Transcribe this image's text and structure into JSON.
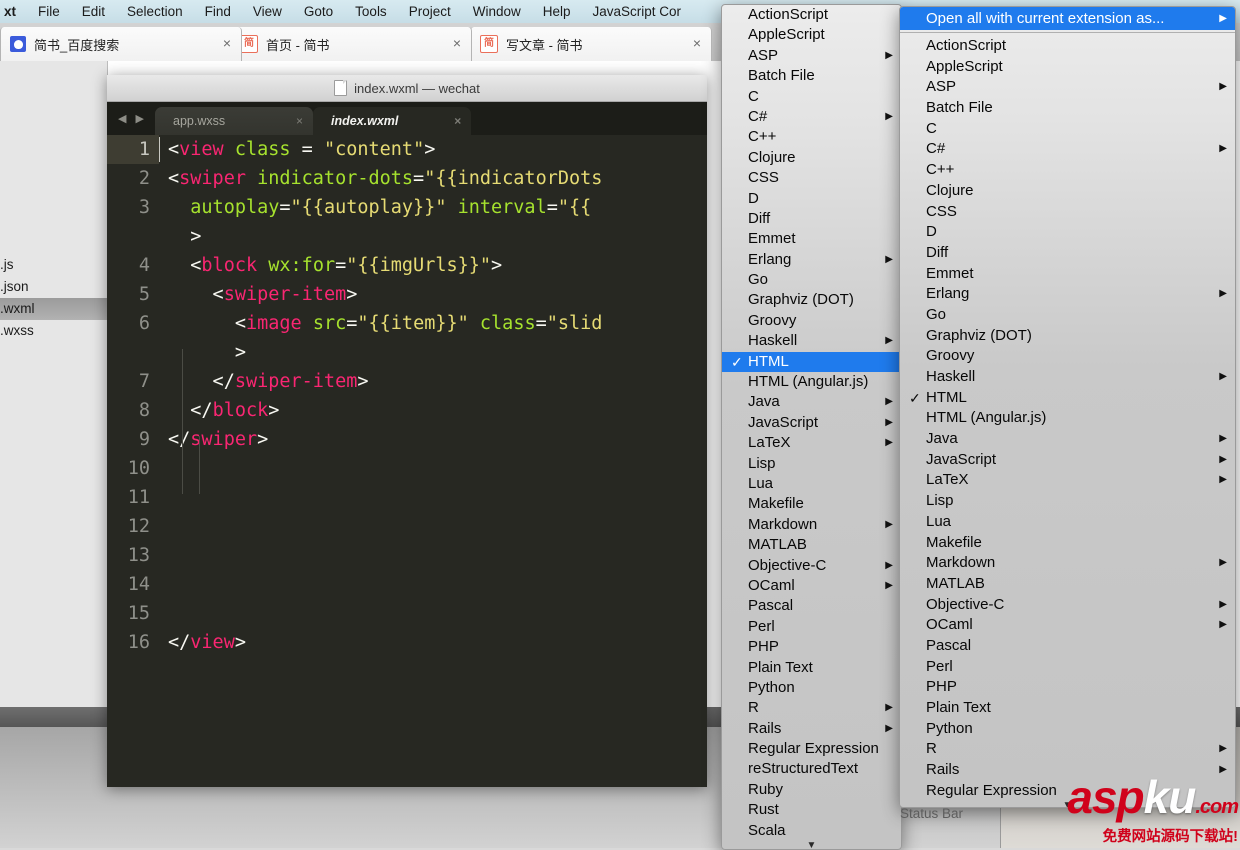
{
  "mac_menubar": {
    "items": [
      {
        "label": "xt",
        "name": "app-name"
      },
      {
        "label": "File"
      },
      {
        "label": "Edit"
      },
      {
        "label": "Selection"
      },
      {
        "label": "Find"
      },
      {
        "label": "View"
      },
      {
        "label": "Goto"
      },
      {
        "label": "Tools"
      },
      {
        "label": "Project"
      },
      {
        "label": "Window"
      },
      {
        "label": "Help"
      },
      {
        "label": "JavaScript Cor"
      }
    ]
  },
  "browser": {
    "tabs": [
      {
        "title": "简书_百度搜索",
        "favicon": "baidu-paw-icon",
        "favicon_char": "",
        "close": "×"
      },
      {
        "title": "首页 - 简书",
        "favicon": "jianshu-icon",
        "favicon_char": "简",
        "close": "×"
      },
      {
        "title": "写文章 - 简书",
        "favicon": "jianshu-icon",
        "favicon_char": "简",
        "close": "×"
      }
    ],
    "sidebar_files": [
      ".js",
      ".json",
      ".wxml",
      ".wxss"
    ],
    "sidebar_selected_index": 2
  },
  "sublime": {
    "window_title": "index.wxml — wechat",
    "title_icon": "document-icon",
    "nav_prev_icon": "◀",
    "nav_next_icon": "▶",
    "tabs": [
      {
        "name": "app.wxss",
        "active": false,
        "close": "×"
      },
      {
        "name": "index.wxml",
        "active": true,
        "close": "×"
      }
    ],
    "status_bar_label": "Status Bar",
    "code_lines": [
      {
        "num": "1",
        "current": true,
        "tokens": [
          {
            "t": "<",
            "c": "wht"
          },
          {
            "t": "view",
            "c": "pnk"
          },
          {
            "t": " ",
            "c": "wht"
          },
          {
            "t": "class",
            "c": "grn"
          },
          {
            "t": " = ",
            "c": "wht"
          },
          {
            "t": "\"content\"",
            "c": "yel"
          },
          {
            "t": ">",
            "c": "wht"
          }
        ]
      },
      {
        "num": "2",
        "current": false,
        "tokens": [
          {
            "t": "<",
            "c": "wht"
          },
          {
            "t": "swiper",
            "c": "pnk"
          },
          {
            "t": " ",
            "c": "wht"
          },
          {
            "t": "indicator-dots",
            "c": "grn"
          },
          {
            "t": "=",
            "c": "wht"
          },
          {
            "t": "\"{{indicatorDots",
            "c": "yel"
          }
        ]
      },
      {
        "num": "3",
        "current": false,
        "tokens": [
          {
            "t": "  ",
            "c": "wht"
          },
          {
            "t": "autoplay",
            "c": "grn"
          },
          {
            "t": "=",
            "c": "wht"
          },
          {
            "t": "\"{{autoplay}}\"",
            "c": "yel"
          },
          {
            "t": " ",
            "c": "wht"
          },
          {
            "t": "interval",
            "c": "grn"
          },
          {
            "t": "=",
            "c": "wht"
          },
          {
            "t": "\"{{",
            "c": "yel"
          }
        ]
      },
      {
        "num": "",
        "current": false,
        "tokens": [
          {
            "t": "  >",
            "c": "wht"
          }
        ]
      },
      {
        "num": "4",
        "current": false,
        "tokens": [
          {
            "t": "  <",
            "c": "wht"
          },
          {
            "t": "block",
            "c": "pnk"
          },
          {
            "t": " ",
            "c": "wht"
          },
          {
            "t": "wx:for",
            "c": "grn"
          },
          {
            "t": "=",
            "c": "wht"
          },
          {
            "t": "\"{{imgUrls}}\"",
            "c": "yel"
          },
          {
            "t": ">",
            "c": "wht"
          }
        ]
      },
      {
        "num": "5",
        "current": false,
        "tokens": [
          {
            "t": "    <",
            "c": "wht"
          },
          {
            "t": "swiper-item",
            "c": "pnk"
          },
          {
            "t": ">",
            "c": "wht"
          }
        ]
      },
      {
        "num": "6",
        "current": false,
        "tokens": [
          {
            "t": "      <",
            "c": "wht"
          },
          {
            "t": "image",
            "c": "pnk"
          },
          {
            "t": " ",
            "c": "wht"
          },
          {
            "t": "src",
            "c": "grn"
          },
          {
            "t": "=",
            "c": "wht"
          },
          {
            "t": "\"{{item}}\"",
            "c": "yel"
          },
          {
            "t": " ",
            "c": "wht"
          },
          {
            "t": "class",
            "c": "grn"
          },
          {
            "t": "=",
            "c": "wht"
          },
          {
            "t": "\"slid",
            "c": "yel"
          }
        ]
      },
      {
        "num": "",
        "current": false,
        "tokens": [
          {
            "t": "      >",
            "c": "wht"
          }
        ]
      },
      {
        "num": "7",
        "current": false,
        "tokens": [
          {
            "t": "    </",
            "c": "wht"
          },
          {
            "t": "swiper-item",
            "c": "pnk"
          },
          {
            "t": ">",
            "c": "wht"
          }
        ]
      },
      {
        "num": "8",
        "current": false,
        "tokens": [
          {
            "t": "  </",
            "c": "wht"
          },
          {
            "t": "block",
            "c": "pnk"
          },
          {
            "t": ">",
            "c": "wht"
          }
        ]
      },
      {
        "num": "9",
        "current": false,
        "tokens": [
          {
            "t": "</",
            "c": "wht"
          },
          {
            "t": "swiper",
            "c": "pnk"
          },
          {
            "t": ">",
            "c": "wht"
          }
        ]
      },
      {
        "num": "10",
        "current": false,
        "tokens": []
      },
      {
        "num": "11",
        "current": false,
        "tokens": []
      },
      {
        "num": "12",
        "current": false,
        "tokens": []
      },
      {
        "num": "13",
        "current": false,
        "tokens": []
      },
      {
        "num": "14",
        "current": false,
        "tokens": []
      },
      {
        "num": "15",
        "current": false,
        "tokens": []
      },
      {
        "num": "16",
        "current": false,
        "tokens": [
          {
            "t": "</",
            "c": "wht"
          },
          {
            "t": "view",
            "c": "pnk"
          },
          {
            "t": ">",
            "c": "wht"
          }
        ]
      }
    ]
  },
  "menu_syntax": {
    "name": "syntax-menu",
    "scroll_down_icon": "▼",
    "checked_item": "HTML",
    "items": [
      {
        "label": "ActionScript",
        "submenu": false,
        "checked": false
      },
      {
        "label": "AppleScript",
        "submenu": false,
        "checked": false
      },
      {
        "label": "ASP",
        "submenu": true,
        "checked": false
      },
      {
        "label": "Batch File",
        "submenu": false,
        "checked": false
      },
      {
        "label": "C",
        "submenu": false,
        "checked": false
      },
      {
        "label": "C#",
        "submenu": true,
        "checked": false
      },
      {
        "label": "C++",
        "submenu": false,
        "checked": false
      },
      {
        "label": "Clojure",
        "submenu": false,
        "checked": false
      },
      {
        "label": "CSS",
        "submenu": false,
        "checked": false
      },
      {
        "label": "D",
        "submenu": false,
        "checked": false
      },
      {
        "label": "Diff",
        "submenu": false,
        "checked": false
      },
      {
        "label": "Emmet",
        "submenu": false,
        "checked": false
      },
      {
        "label": "Erlang",
        "submenu": true,
        "checked": false
      },
      {
        "label": "Go",
        "submenu": false,
        "checked": false
      },
      {
        "label": "Graphviz (DOT)",
        "submenu": false,
        "checked": false
      },
      {
        "label": "Groovy",
        "submenu": false,
        "checked": false
      },
      {
        "label": "Haskell",
        "submenu": true,
        "checked": false
      },
      {
        "label": "HTML",
        "submenu": false,
        "checked": true,
        "selected": true
      },
      {
        "label": "HTML (Angular.js)",
        "submenu": false,
        "checked": false
      },
      {
        "label": "Java",
        "submenu": true,
        "checked": false
      },
      {
        "label": "JavaScript",
        "submenu": true,
        "checked": false
      },
      {
        "label": "LaTeX",
        "submenu": true,
        "checked": false
      },
      {
        "label": "Lisp",
        "submenu": false,
        "checked": false
      },
      {
        "label": "Lua",
        "submenu": false,
        "checked": false
      },
      {
        "label": "Makefile",
        "submenu": false,
        "checked": false
      },
      {
        "label": "Markdown",
        "submenu": true,
        "checked": false
      },
      {
        "label": "MATLAB",
        "submenu": false,
        "checked": false
      },
      {
        "label": "Objective-C",
        "submenu": true,
        "checked": false
      },
      {
        "label": "OCaml",
        "submenu": true,
        "checked": false
      },
      {
        "label": "Pascal",
        "submenu": false,
        "checked": false
      },
      {
        "label": "Perl",
        "submenu": false,
        "checked": false
      },
      {
        "label": "PHP",
        "submenu": false,
        "checked": false
      },
      {
        "label": "Plain Text",
        "submenu": false,
        "checked": false
      },
      {
        "label": "Python",
        "submenu": false,
        "checked": false
      },
      {
        "label": "R",
        "submenu": true,
        "checked": false
      },
      {
        "label": "Rails",
        "submenu": true,
        "checked": false
      },
      {
        "label": "Regular Expression",
        "submenu": false,
        "checked": false
      },
      {
        "label": "reStructuredText",
        "submenu": false,
        "checked": false
      },
      {
        "label": "Ruby",
        "submenu": false,
        "checked": false
      },
      {
        "label": "Rust",
        "submenu": false,
        "checked": false
      },
      {
        "label": "Scala",
        "submenu": false,
        "checked": false
      }
    ]
  },
  "menu_submenu": {
    "name": "open-all-with-extension-submenu",
    "header": {
      "label": "Open all with current extension as...",
      "submenu": true,
      "selected": true
    },
    "scroll_down_icon": "▼",
    "items": [
      {
        "label": "ActionScript",
        "submenu": false,
        "checked": false
      },
      {
        "label": "AppleScript",
        "submenu": false,
        "checked": false
      },
      {
        "label": "ASP",
        "submenu": true,
        "checked": false
      },
      {
        "label": "Batch File",
        "submenu": false,
        "checked": false
      },
      {
        "label": "C",
        "submenu": false,
        "checked": false
      },
      {
        "label": "C#",
        "submenu": true,
        "checked": false
      },
      {
        "label": "C++",
        "submenu": false,
        "checked": false
      },
      {
        "label": "Clojure",
        "submenu": false,
        "checked": false
      },
      {
        "label": "CSS",
        "submenu": false,
        "checked": false
      },
      {
        "label": "D",
        "submenu": false,
        "checked": false
      },
      {
        "label": "Diff",
        "submenu": false,
        "checked": false
      },
      {
        "label": "Emmet",
        "submenu": false,
        "checked": false
      },
      {
        "label": "Erlang",
        "submenu": true,
        "checked": false
      },
      {
        "label": "Go",
        "submenu": false,
        "checked": false
      },
      {
        "label": "Graphviz (DOT)",
        "submenu": false,
        "checked": false
      },
      {
        "label": "Groovy",
        "submenu": false,
        "checked": false
      },
      {
        "label": "Haskell",
        "submenu": true,
        "checked": false
      },
      {
        "label": "HTML",
        "submenu": false,
        "checked": true
      },
      {
        "label": "HTML (Angular.js)",
        "submenu": false,
        "checked": false
      },
      {
        "label": "Java",
        "submenu": true,
        "checked": false
      },
      {
        "label": "JavaScript",
        "submenu": true,
        "checked": false
      },
      {
        "label": "LaTeX",
        "submenu": true,
        "checked": false
      },
      {
        "label": "Lisp",
        "submenu": false,
        "checked": false
      },
      {
        "label": "Lua",
        "submenu": false,
        "checked": false
      },
      {
        "label": "Makefile",
        "submenu": false,
        "checked": false
      },
      {
        "label": "Markdown",
        "submenu": true,
        "checked": false
      },
      {
        "label": "MATLAB",
        "submenu": false,
        "checked": false
      },
      {
        "label": "Objective-C",
        "submenu": true,
        "checked": false
      },
      {
        "label": "OCaml",
        "submenu": true,
        "checked": false
      },
      {
        "label": "Pascal",
        "submenu": false,
        "checked": false
      },
      {
        "label": "Perl",
        "submenu": false,
        "checked": false
      },
      {
        "label": "PHP",
        "submenu": false,
        "checked": false
      },
      {
        "label": "Plain Text",
        "submenu": false,
        "checked": false
      },
      {
        "label": "Python",
        "submenu": false,
        "checked": false
      },
      {
        "label": "R",
        "submenu": true,
        "checked": false
      },
      {
        "label": "Rails",
        "submenu": true,
        "checked": false
      },
      {
        "label": "Regular Expression",
        "submenu": false,
        "checked": false
      }
    ]
  },
  "watermark": {
    "part_asp": "asp",
    "part_ku": "ku",
    "part_com": ".com",
    "subtitle": "免费网站源码下载站!"
  },
  "colors": {
    "menu_highlight": "#1f7bed",
    "editor_bg": "#272822",
    "tag": "#f92672",
    "attribute": "#a6e22e",
    "string": "#e6db74",
    "punctuation": "#f8f8f2",
    "gutter": "#8f908a",
    "watermark_red": "#d0021b"
  }
}
